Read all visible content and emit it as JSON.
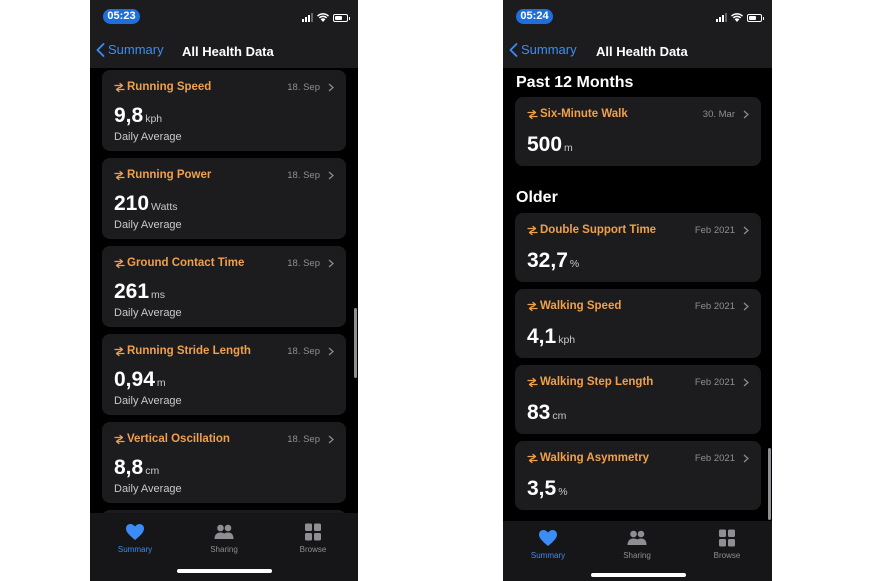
{
  "left": {
    "status_time": "05:23",
    "back_label": "Summary",
    "nav_title": "All Health Data",
    "cards": [
      {
        "title": "Running Speed",
        "date": "18. Sep",
        "value": "9,8",
        "unit": "kph",
        "sub": "Daily Average"
      },
      {
        "title": "Running Power",
        "date": "18. Sep",
        "value": "210",
        "unit": "Watts",
        "sub": "Daily Average"
      },
      {
        "title": "Ground Contact Time",
        "date": "18. Sep",
        "value": "261",
        "unit": "ms",
        "sub": "Daily Average"
      },
      {
        "title": "Running Stride Length",
        "date": "18. Sep",
        "value": "0,94",
        "unit": "m",
        "sub": "Daily Average"
      },
      {
        "title": "Vertical Oscillation",
        "date": "18. Sep",
        "value": "8,8",
        "unit": "cm",
        "sub": "Daily Average"
      }
    ]
  },
  "right": {
    "status_time": "05:24",
    "back_label": "Summary",
    "nav_title": "All Health Data",
    "section_past": "Past 12 Months",
    "section_older": "Older",
    "cards": [
      {
        "title": "Six-Minute Walk",
        "date": "30. Mar",
        "value": "500",
        "unit": "m"
      },
      {
        "title": "Double Support Time",
        "date": "Feb 2021",
        "value": "32,7",
        "unit": "%"
      },
      {
        "title": "Walking Speed",
        "date": "Feb 2021",
        "value": "4,1",
        "unit": "kph"
      },
      {
        "title": "Walking Step Length",
        "date": "Feb 2021",
        "value": "83",
        "unit": "cm"
      },
      {
        "title": "Walking Asymmetry",
        "date": "Feb 2021",
        "value": "3,5",
        "unit": "%"
      }
    ]
  },
  "tabs": {
    "summary": "Summary",
    "sharing": "Sharing",
    "browse": "Browse"
  },
  "icons": {
    "metric": "running-metric-icon",
    "back": "chevron-left-icon",
    "summary": "heart-icon",
    "sharing": "people-icon",
    "browse": "grid-icon"
  },
  "colors": {
    "accent": "#3c8cf5",
    "metric_title": "#f0a04b",
    "time_pill": "#1e6fdc",
    "card_bg": "#1c1c1e",
    "background": "#000000"
  }
}
